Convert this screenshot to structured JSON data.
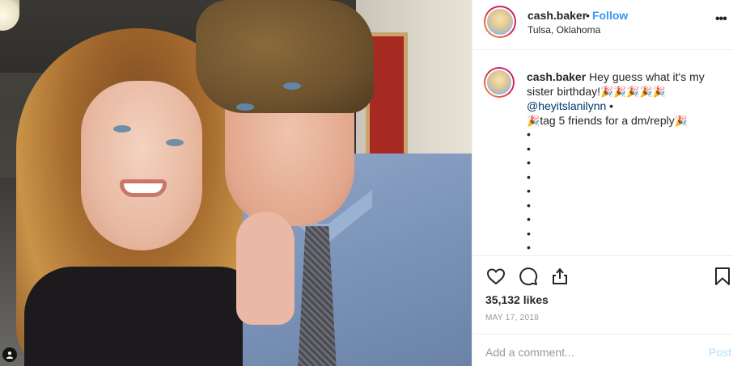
{
  "post": {
    "username": "cash.baker",
    "separator": "•",
    "follow_label": "Follow",
    "location": "Tulsa, Oklahoma",
    "more_label": "•••"
  },
  "caption": {
    "username": "cash.baker",
    "line1": "Hey guess what it's my sister birthday!",
    "emoji": "🎉",
    "mention": "@heyitslanilynn",
    "mention_suffix": " •",
    "line3_prefix": "🎉",
    "line3": "tag 5 friends for a dm/reply",
    "line3_suffix": "🎉",
    "bullets": [
      "•",
      "•",
      "•",
      "•",
      "•",
      "•",
      "•",
      "•",
      "•"
    ]
  },
  "actions": {
    "like_icon": "heart-icon",
    "comment_icon": "comment-icon",
    "share_icon": "share-icon",
    "save_icon": "bookmark-icon",
    "likes": "35,132 likes",
    "date": "MAY 17, 2018"
  },
  "comment": {
    "placeholder": "Add a comment...",
    "post_label": "Post"
  },
  "colors": {
    "follow": "#3897f0",
    "post_disabled": "#b2dffc",
    "muted": "#999999",
    "text": "#262626",
    "divider": "#efefef"
  }
}
